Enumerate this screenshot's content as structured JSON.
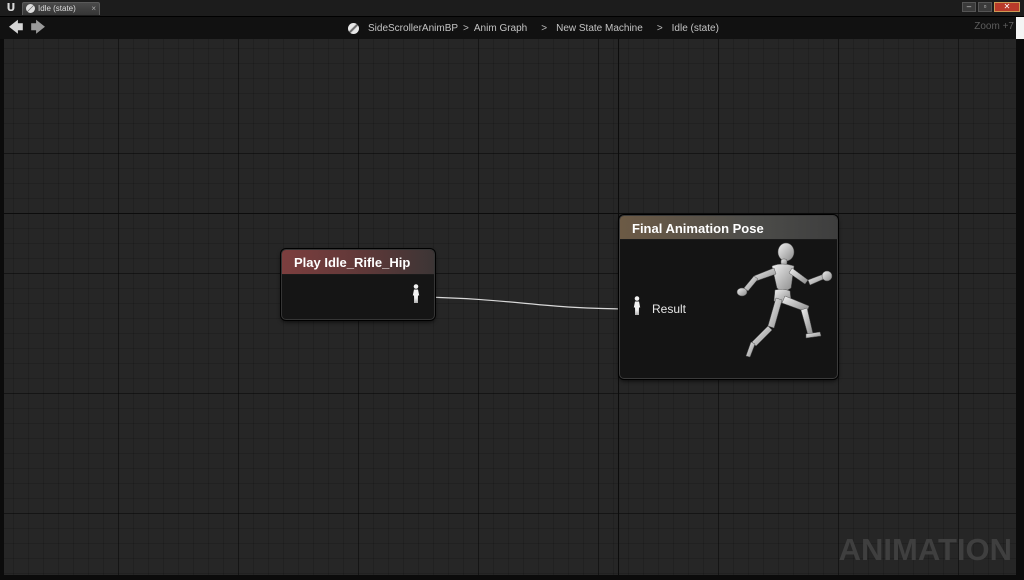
{
  "window": {
    "tab_label": "Idle (state)",
    "tab_close": "×",
    "buttons": {
      "minimize": "–",
      "restore": "▫",
      "close": "✕"
    }
  },
  "nav": {
    "back_icon": "back-arrow-icon",
    "forward_icon": "forward-arrow-icon",
    "breadcrumbs": [
      "SideScrollerAnimBP",
      "Anim Graph",
      "New State Machine",
      "Idle (state)"
    ],
    "separator": ">",
    "zoom": "Zoom +7"
  },
  "nodes": {
    "play": {
      "title": "Play Idle_Rifle_Hip",
      "header_color": "#7c3e3e"
    },
    "final": {
      "title": "Final Animation Pose",
      "pin_label": "Result",
      "header_color": "#6c5a45"
    }
  },
  "watermark": "ANIMATION"
}
